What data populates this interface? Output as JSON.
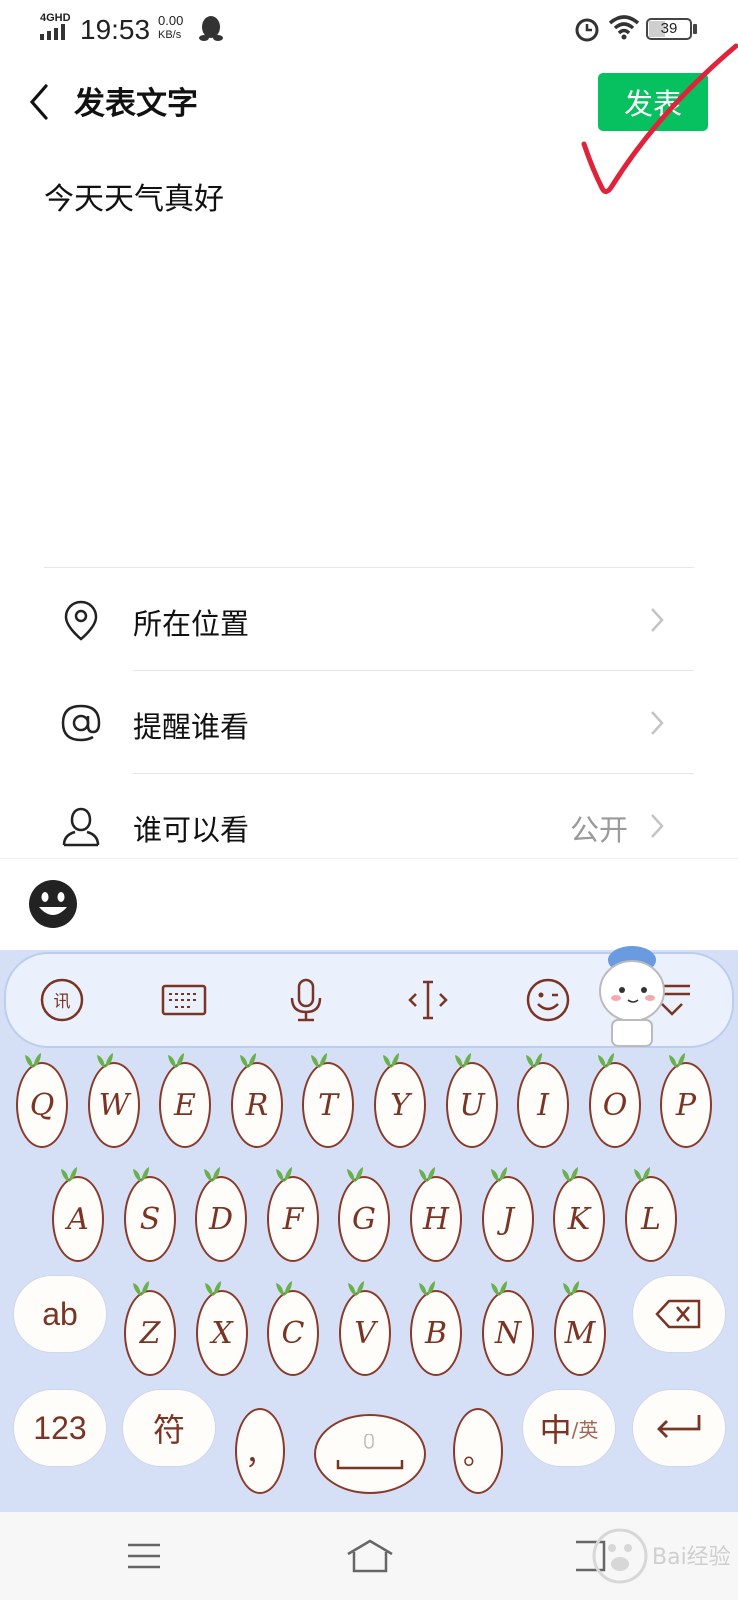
{
  "status_bar": {
    "network": "4GHD",
    "time": "19:53",
    "speed_value": "0.00",
    "speed_unit": "KB/s",
    "battery": "39"
  },
  "header": {
    "title": "发表文字",
    "publish_label": "发表"
  },
  "post": {
    "text": "今天天气真好"
  },
  "options": [
    {
      "label": "所在位置",
      "value": "",
      "icon": "location-pin-icon"
    },
    {
      "label": "提醒谁看",
      "value": "",
      "icon": "at-sign-icon"
    },
    {
      "label": "谁可以看",
      "value": "公开",
      "icon": "person-icon"
    }
  ],
  "keyboard": {
    "toolbar_icons": [
      "ime-logo-icon",
      "keyboard-icon",
      "microphone-icon",
      "cursor-icon",
      "smiley-icon",
      "collapse-icon"
    ],
    "row1": [
      "Q",
      "W",
      "E",
      "R",
      "T",
      "Y",
      "U",
      "I",
      "O",
      "P"
    ],
    "row2": [
      "A",
      "S",
      "D",
      "F",
      "G",
      "H",
      "J",
      "K",
      "L"
    ],
    "row3": [
      "Z",
      "X",
      "C",
      "V",
      "B",
      "N",
      "M"
    ],
    "shift_label": "ab",
    "num_label": "123",
    "symbol_label": "符",
    "comma_label": "，",
    "period_label": "。",
    "lang_main": "中",
    "lang_sub": "/英"
  },
  "accent_color": "#07c160",
  "annotation_color": "#e0233a",
  "watermark": "Baidu经验"
}
